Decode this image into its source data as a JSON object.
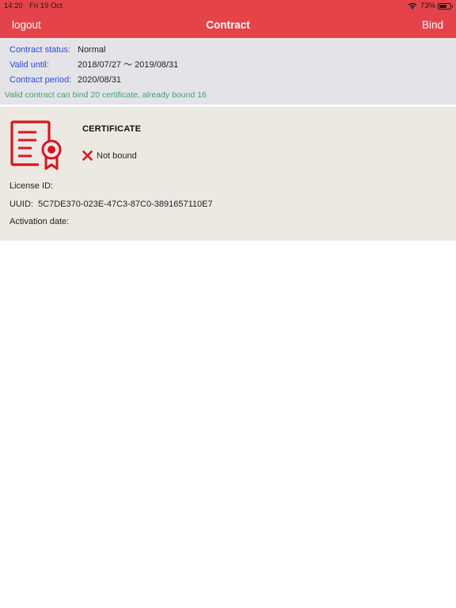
{
  "status_bar": {
    "time": "14:20",
    "date": "Fri 19 Oct",
    "battery": "73%",
    "battery_level": 0.73,
    "icons": [
      "wifi-icon",
      "battery-icon"
    ]
  },
  "nav": {
    "left_label": "logout",
    "title": "Contract",
    "right_label": "Bind"
  },
  "contract": {
    "status_label": "Contract status:",
    "status_value": "Normal",
    "valid_label": "Valid until:",
    "valid_value": "2018/07/27 ～ 2019/08/31",
    "period_label": "Contract period:",
    "period_value": "2020/08/31",
    "bind_note": "Valid contract can bind 20 certificate, already bound 16"
  },
  "certificate": {
    "icon": "certificate-icon",
    "title": "CERTIFICATE",
    "status_icon": "x-icon",
    "status": "Not bound",
    "license_label": "License ID:",
    "license_value": "",
    "uuid_label": "UUID:",
    "uuid_value": "5C7DE370-023E-47C3-87C0-3891657110E7",
    "activation_label": "Activation date:",
    "activation_value": ""
  },
  "colors": {
    "header_bg": "#e5434a",
    "label_blue": "#2b4bd8",
    "note_green": "#3aa66a",
    "icon_red": "#e0121f",
    "info_bg": "#e4e3e8",
    "card_bg": "#ece9e3"
  }
}
